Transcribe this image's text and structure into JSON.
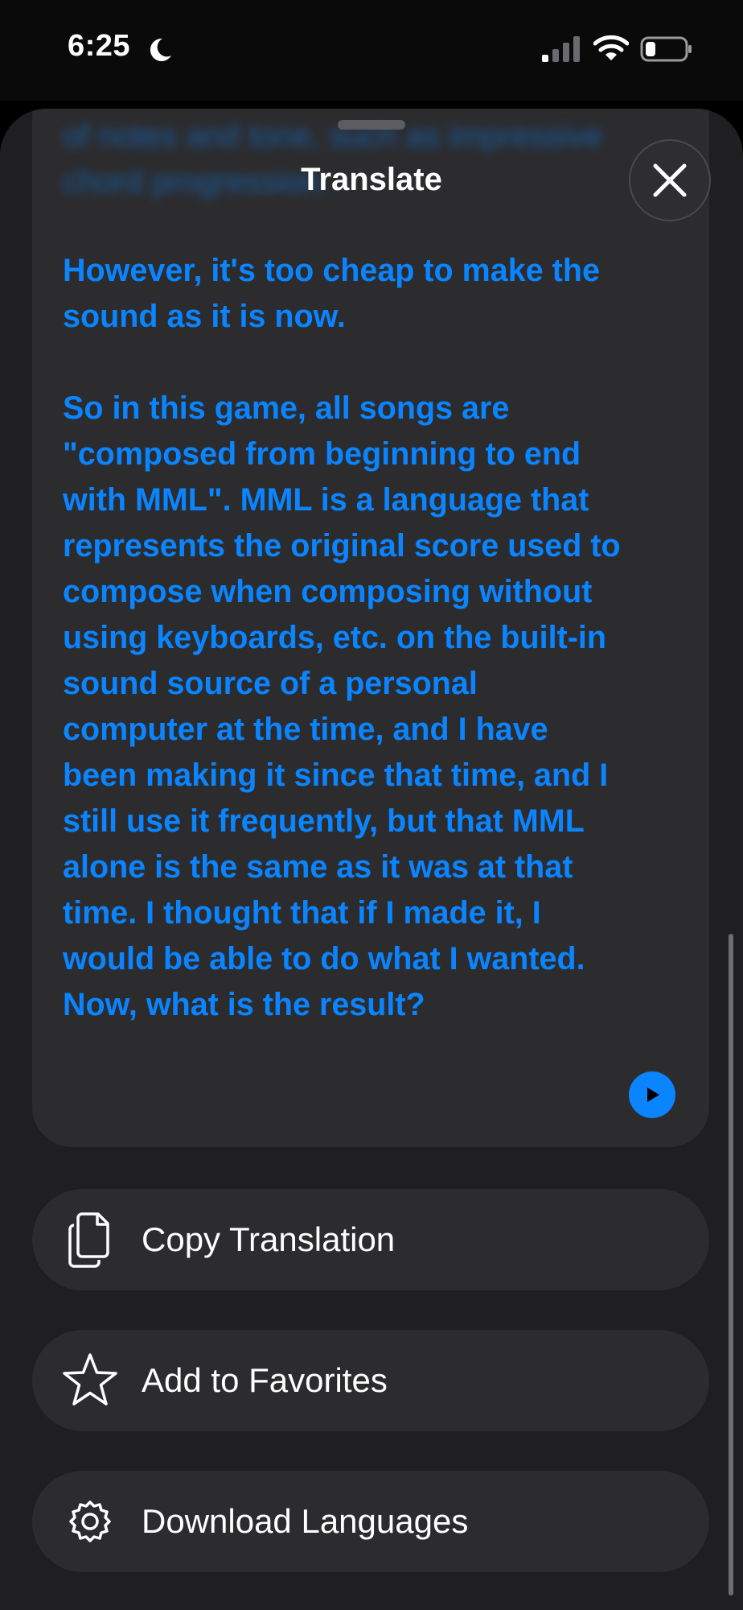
{
  "status_bar": {
    "time": "6:25",
    "icons": [
      "moon-icon",
      "cellular-signal-icon",
      "wifi-icon",
      "battery-icon"
    ]
  },
  "sheet": {
    "title": "Translate",
    "close_icon": "close-icon",
    "faded_text": "of notes and tone, such as impressive chord progression.",
    "translation": "However, it's too cheap to make the sound as it is now.\n\nSo in this game, all songs are \"composed from beginning to end with MML\". MML is a language that represents the original score used to compose when composing without using keyboards, etc. on the built-in sound source of a personal computer at the time, and I have been making it since that time, and I still use it frequently, but that MML alone is the same as it was at that time. I thought that if I made it, I would be able to do what I wanted. Now, what is the result?",
    "play_icon": "play-icon"
  },
  "actions": [
    {
      "label": "Copy Translation",
      "icon": "copy-icon"
    },
    {
      "label": "Add to Favorites",
      "icon": "star-icon"
    },
    {
      "label": "Download Languages",
      "icon": "download-languages-icon"
    }
  ],
  "colors": {
    "accent": "#0a84ff",
    "sheet_bg": "#1f1f21",
    "card_bg": "#2c2c2e"
  }
}
